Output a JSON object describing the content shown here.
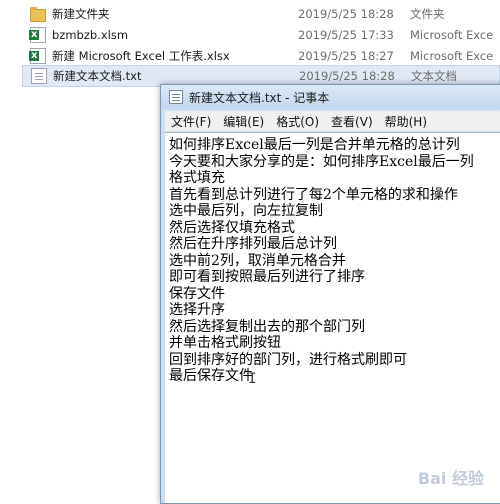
{
  "explorer": {
    "files": [
      {
        "icon": "folder-icon",
        "name": "新建文件夹",
        "date": "2019/5/25 18:28",
        "type": "文件夹"
      },
      {
        "icon": "excel-macro-icon",
        "name": "bzmbzb.xlsm",
        "date": "2019/5/25 17:33",
        "type": "Microsoft Exce"
      },
      {
        "icon": "excel-icon",
        "name": "新建 Microsoft Excel 工作表.xlsx",
        "date": "2019/5/25 18:27",
        "type": "Microsoft Exce"
      },
      {
        "icon": "text-file-icon",
        "name": "新建文本文档.txt",
        "date": "2019/5/25 18:28",
        "type": "文本文档"
      }
    ]
  },
  "notepad": {
    "title": "新建文本文档.txt - 记事本",
    "menu": [
      "文件(F)",
      "编辑(E)",
      "格式(O)",
      "查看(V)",
      "帮助(H)"
    ],
    "lines": [
      "如何排序Excel最后一列是合并单元格的总计列",
      "今天要和大家分享的是：如何排序Excel最后一列",
      "格式填充",
      "首先看到总计列进行了每2个单元格的求和操作",
      "选中最后列，向左拉复制",
      "然后选择仅填充格式",
      "然后在升序排列最后总计列",
      "选中前2列，取消单元格合并",
      "即可看到按照最后列进行了排序",
      "保存文件",
      "选择升序",
      "然后选择复制出去的那个部门列",
      "并单击格式刷按钮",
      "回到排序好的部门列，进行格式刷即可",
      "最后保存文件"
    ]
  },
  "watermark": "Bai 经验"
}
